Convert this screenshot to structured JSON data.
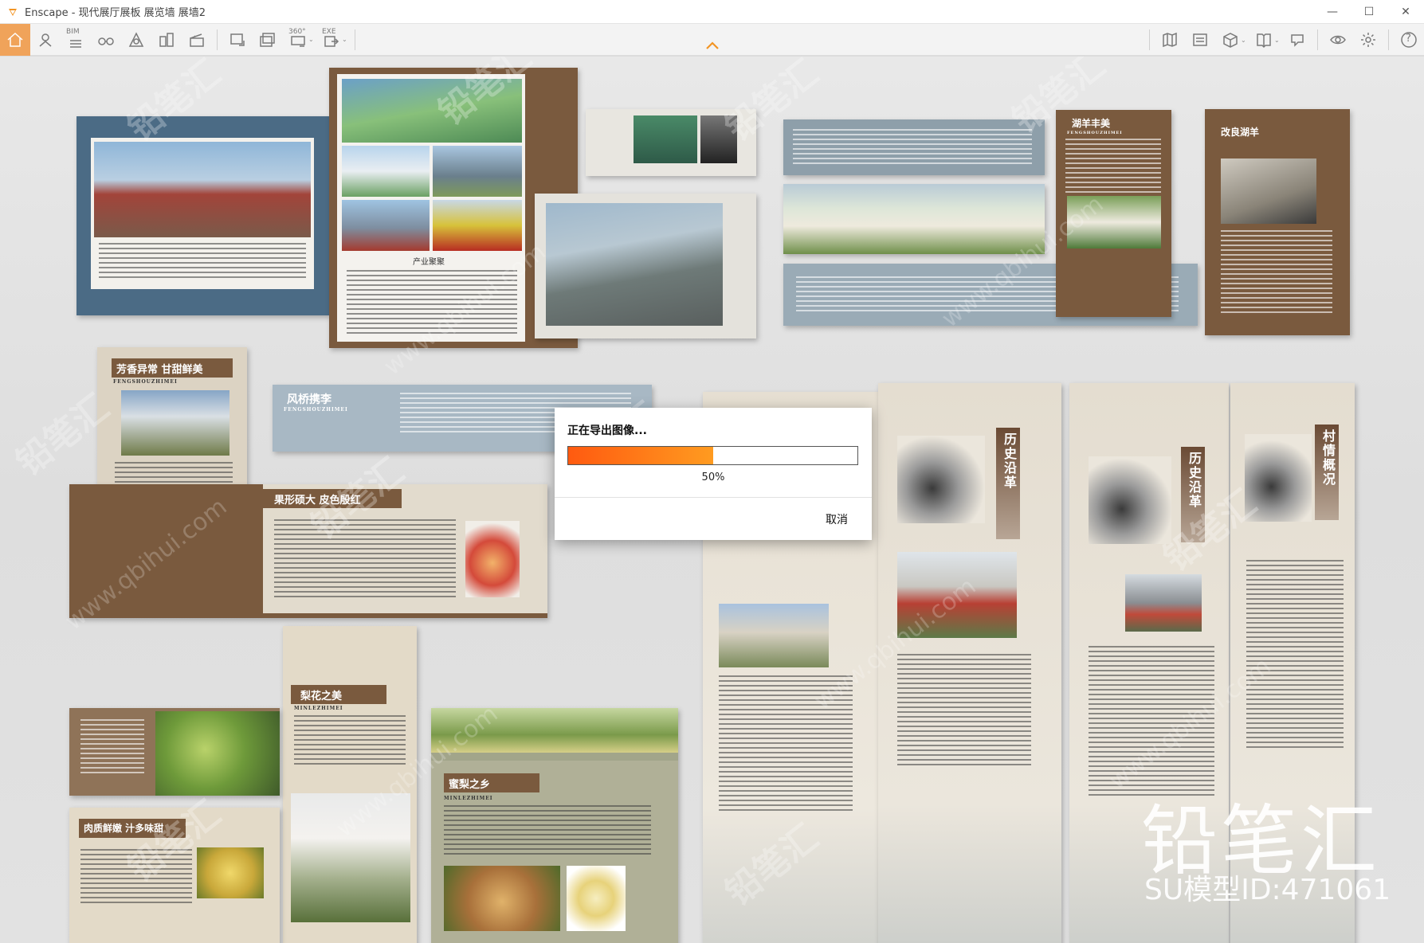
{
  "window": {
    "title": "Enscape - 现代展厅展板 展览墙 展墙2",
    "minimize": "—",
    "maximize": "☐",
    "close": "✕"
  },
  "toolbar": {
    "bim_label": "BIM",
    "pano_label": "360°",
    "exe_label": "EXE",
    "help_label": "?"
  },
  "panels": {
    "fengxiang": "芳香异常 甘甜鲜美",
    "fengqiao": "风桥携李",
    "guoxing": "果形硕大 皮色殷红",
    "lihua": "梨花之美",
    "mili": "蜜梨之乡",
    "rouzhi": "肉质鲜嫩 汁多味甜",
    "huyang": "湖羊丰美",
    "gailiang": "改良湖羊",
    "chanye": "产业聚聚",
    "lishi1": "历史沿革",
    "lishi2": "历史沿革",
    "cunqing": "村情概况",
    "pinyin_fsz": "FENGSHOUZHIMEI",
    "pinyin_mlz": "MINLEZHIMEI"
  },
  "dialog": {
    "title": "正在导出图像...",
    "progress": 0.5,
    "progress_text": "50%",
    "cancel": "取消"
  },
  "watermark": {
    "brand": "铅笔汇",
    "model_id": "SU模型ID:471061",
    "tile": "铅笔汇",
    "url": "www.qbihui.com"
  },
  "colors": {
    "accent": "#f0a35a",
    "brown": "#7a5a3e",
    "slate": "#4b6b85",
    "progress_start": "#ff5a10",
    "progress_end": "#ff9b20"
  }
}
